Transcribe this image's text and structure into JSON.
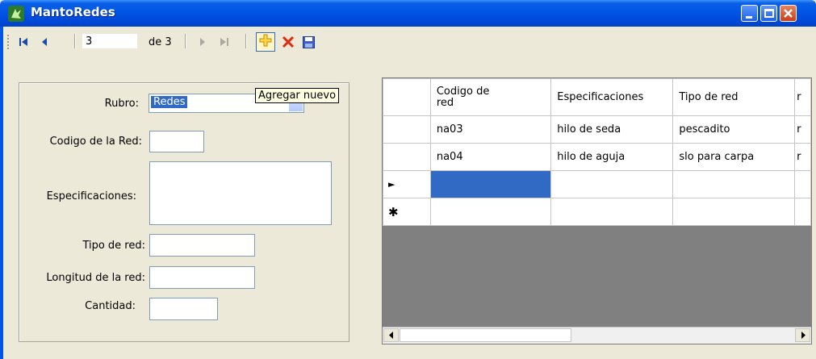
{
  "window": {
    "title": "MantoRedes",
    "icon": "app-icon",
    "controls": [
      "minimize-icon",
      "maximize-icon",
      "close-icon"
    ]
  },
  "navigator": {
    "position": "3",
    "of_label": "de 3",
    "buttons": [
      "move-first-icon",
      "move-previous-icon",
      "move-next-icon",
      "move-last-icon",
      "add-new-icon",
      "delete-icon",
      "save-icon"
    ],
    "tooltip": "Agregar nuevo"
  },
  "form": {
    "rubro_label": "Rubro:",
    "rubro_value": "Redes",
    "codigo_label": "Codigo de la Red:",
    "especificaciones_label": "Especificaciones:",
    "tipo_label": "Tipo de red:",
    "longitud_label": "Longitud  de la red:",
    "cantidad_label": "Cantidad:"
  },
  "grid": {
    "columns": [
      "Codigo de\nred",
      "Especificaciones",
      "Tipo de red",
      "r"
    ],
    "rows": [
      [
        "na03",
        "hilo de seda",
        "pescadito",
        "r"
      ],
      [
        "na04",
        "hilo de aguja",
        "slo para carpa",
        "r"
      ]
    ],
    "current_row_marker": "►",
    "new_row_marker": "✱"
  },
  "colors": {
    "titlebar": "#0055e5",
    "selection": "#316ac5",
    "window_bg": "#ece9d8",
    "grid_bg": "#808080",
    "tooltip_bg": "#ffffe1"
  }
}
